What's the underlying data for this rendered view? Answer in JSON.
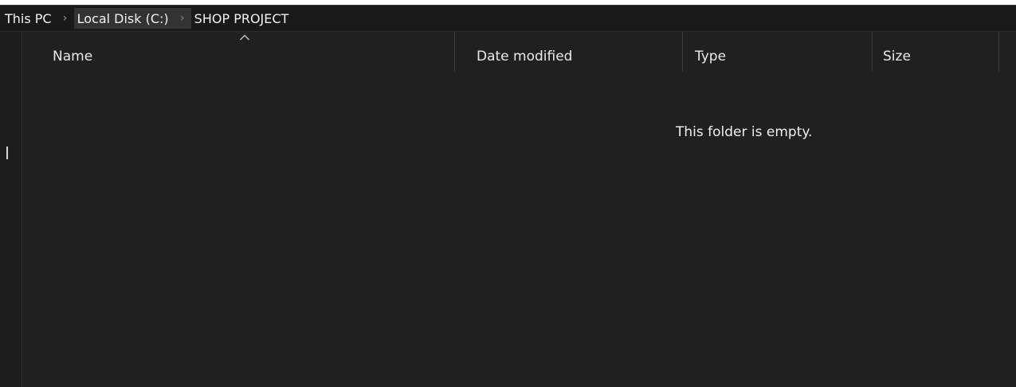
{
  "breadcrumb": {
    "items": [
      "This PC",
      "Local Disk (C:)",
      "SHOP PROJECT"
    ],
    "separator": "›"
  },
  "columns": {
    "name": "Name",
    "date_modified": "Date modified",
    "type": "Type",
    "size": "Size"
  },
  "sort": {
    "column": "Name",
    "direction": "ascending",
    "icon": "chevron-up-icon"
  },
  "main": {
    "empty_message": "This folder is empty."
  },
  "colors": {
    "window_bg": "#202020",
    "address_bg": "#191919",
    "text": "#f0f0f0",
    "highlight": "#333333"
  }
}
